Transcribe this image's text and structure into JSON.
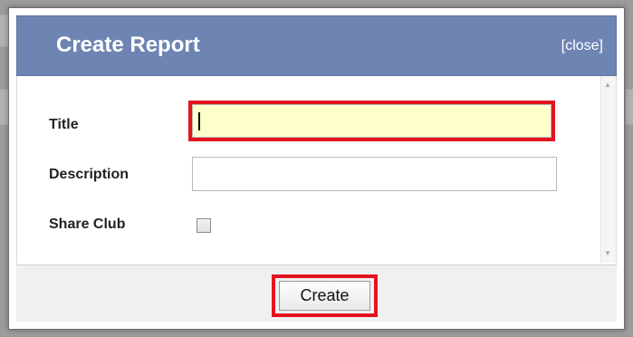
{
  "dialog": {
    "title": "Create Report",
    "close_label": "[close]"
  },
  "form": {
    "title_label": "Title",
    "title_value": "",
    "description_label": "Description",
    "description_value": "",
    "share_club_label": "Share Club",
    "share_club_checked": false
  },
  "footer": {
    "create_label": "Create"
  },
  "icons": {
    "scroll_up": "scroll-up-arrow-icon",
    "scroll_down": "scroll-down-arrow-icon"
  },
  "colors": {
    "header": "#6e84b3",
    "highlight": "#e3141f",
    "focused_input": "#ffffcc"
  }
}
